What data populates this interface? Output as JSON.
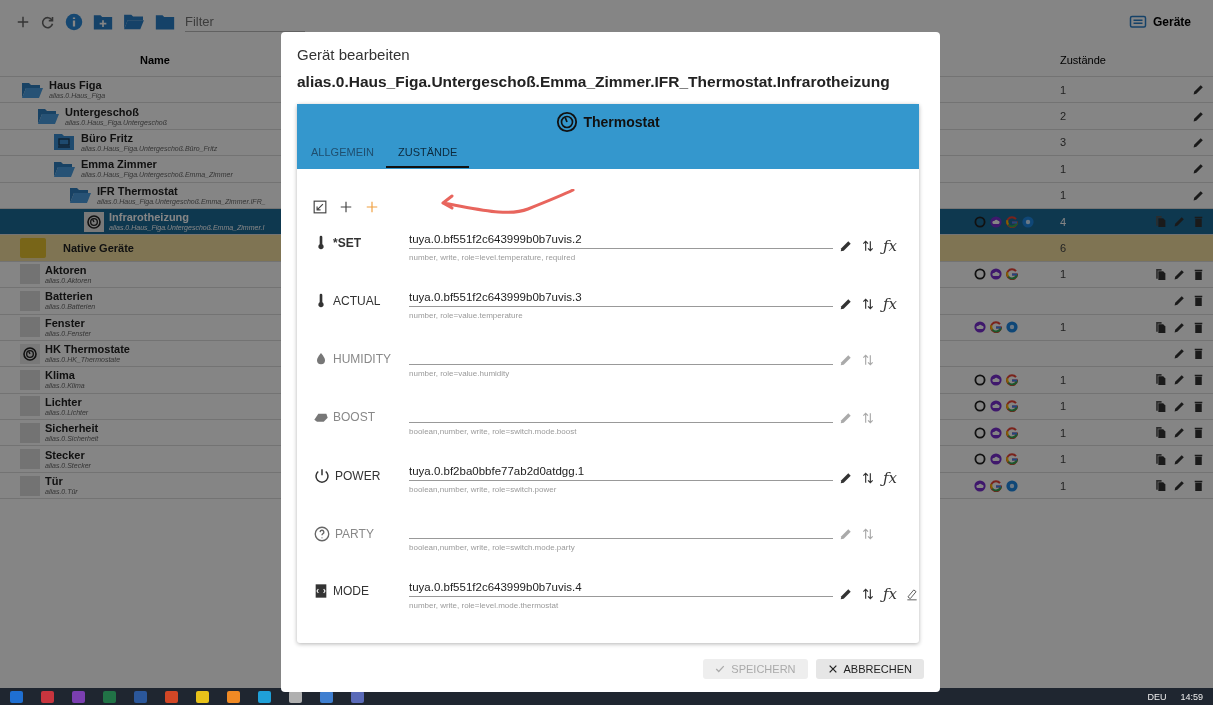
{
  "toolbar": {
    "filter_placeholder": "Filter"
  },
  "header_title": "Geräte",
  "columns": {
    "name": "Name",
    "states": "Zustände"
  },
  "tree": [
    {
      "kind": "folder-open",
      "name": "Haus Figa",
      "id": "alias.0.Haus_Figa",
      "count": "1",
      "actions": [
        {
          "kind": "edit"
        }
      ],
      "selected": false,
      "children": [
        {
          "kind": "folder-open",
          "name": "Untergeschoß",
          "id": "alias.0.Haus_Figa.Untergeschoß",
          "count": "2",
          "actions": [
            {
              "kind": "edit"
            }
          ],
          "selected": false,
          "children": [
            {
              "kind": "folder-laptop",
              "name": "Büro Fritz",
              "id": "alias.0.Haus_Figa.Untergeschoß.Büro_Fritz",
              "count": "3",
              "actions": [
                {
                  "kind": "edit"
                }
              ],
              "selected": false
            },
            {
              "kind": "folder-open",
              "name": "Emma Zimmer",
              "id": "alias.0.Haus_Figa.Untergeschoß.Emma_Zimmer",
              "count": "1",
              "actions": [
                {
                  "kind": "edit"
                }
              ],
              "selected": false,
              "children": [
                {
                  "kind": "folder-open",
                  "name": "IFR Thermostat",
                  "id": "alias.0.Haus_Figa.Untergeschoß.Emma_Zimmer.IFR_",
                  "count": "1",
                  "actions": [
                    {
                      "kind": "edit"
                    }
                  ],
                  "selected": false,
                  "children": [
                    {
                      "kind": "thermostat",
                      "name": "Infrarotheizung",
                      "id": "alias.0.Haus_Figa.Untergeschoß.Emma_Zimmer.I",
                      "count": "4",
                      "actions": [
                        {
                          "kind": "copy"
                        },
                        {
                          "kind": "edit"
                        },
                        {
                          "kind": "delete"
                        }
                      ],
                      "badges": [
                        {
                          "kind": "ring"
                        },
                        {
                          "kind": "cloud"
                        },
                        {
                          "kind": "g"
                        },
                        {
                          "kind": "dot"
                        }
                      ],
                      "selected": true
                    }
                  ]
                }
              ]
            }
          ]
        }
      ]
    }
  ],
  "native": {
    "name": "Native Geräte",
    "count": "6",
    "items": [
      {
        "kind": "blank",
        "name": "Aktoren",
        "id": "alias.0.Aktoren",
        "count": "1",
        "actions": [
          {
            "kind": "copy"
          },
          {
            "kind": "edit"
          },
          {
            "kind": "delete"
          }
        ],
        "badges": [
          {
            "kind": "ring"
          },
          {
            "kind": "cloud"
          },
          {
            "kind": "g"
          }
        ],
        "selected": false
      },
      {
        "kind": "blank",
        "name": "Batterien",
        "id": "alias.0.Batterien",
        "actions": [
          {
            "kind": "edit"
          },
          {
            "kind": "delete"
          }
        ],
        "selected": false
      },
      {
        "kind": "blank",
        "name": "Fenster",
        "id": "alias.0.Fenster",
        "count": "1",
        "actions": [
          {
            "kind": "copy"
          },
          {
            "kind": "edit"
          },
          {
            "kind": "delete"
          }
        ],
        "badges": [
          {
            "kind": "cloud"
          },
          {
            "kind": "g"
          },
          {
            "kind": "dot"
          }
        ],
        "selected": false
      },
      {
        "kind": "thermostat",
        "name": "HK Thermostate",
        "id": "alias.0.HK_Thermostate",
        "actions": [
          {
            "kind": "edit"
          },
          {
            "kind": "delete"
          }
        ],
        "selected": false
      },
      {
        "kind": "blank",
        "name": "Klima",
        "id": "alias.0.Klima",
        "count": "1",
        "actions": [
          {
            "kind": "copy"
          },
          {
            "kind": "edit"
          },
          {
            "kind": "delete"
          }
        ],
        "badges": [
          {
            "kind": "ring"
          },
          {
            "kind": "cloud"
          },
          {
            "kind": "g"
          }
        ],
        "selected": false
      },
      {
        "kind": "blank",
        "name": "Lichter",
        "id": "alias.0.Lichter",
        "count": "1",
        "actions": [
          {
            "kind": "copy"
          },
          {
            "kind": "edit"
          },
          {
            "kind": "delete"
          }
        ],
        "badges": [
          {
            "kind": "ring"
          },
          {
            "kind": "cloud"
          },
          {
            "kind": "g"
          }
        ],
        "selected": false
      },
      {
        "kind": "blank",
        "name": "Sicherheit",
        "id": "alias.0.Sicherheit",
        "count": "1",
        "actions": [
          {
            "kind": "copy"
          },
          {
            "kind": "edit"
          },
          {
            "kind": "delete"
          }
        ],
        "badges": [
          {
            "kind": "ring"
          },
          {
            "kind": "cloud"
          },
          {
            "kind": "g"
          }
        ],
        "selected": false
      },
      {
        "kind": "blank",
        "name": "Stecker",
        "id": "alias.0.Stecker",
        "count": "1",
        "actions": [
          {
            "kind": "copy"
          },
          {
            "kind": "edit"
          },
          {
            "kind": "delete"
          }
        ],
        "badges": [
          {
            "kind": "ring"
          },
          {
            "kind": "cloud"
          },
          {
            "kind": "g"
          }
        ],
        "selected": false
      },
      {
        "kind": "blank",
        "name": "Tür",
        "id": "alias.0.Tür",
        "count": "1",
        "actions": [
          {
            "kind": "copy"
          },
          {
            "kind": "edit"
          },
          {
            "kind": "delete"
          }
        ],
        "badges": [
          {
            "kind": "cloud"
          },
          {
            "kind": "g"
          },
          {
            "kind": "dot"
          }
        ],
        "selected": false
      }
    ]
  },
  "dialog": {
    "title": "Gerät bearbeiten",
    "subtitle": "alias.0.Haus_Figa.Untergeschoß.Emma_Zimmer.IFR_Thermostat.Infrarotheizung",
    "device_type": "Thermostat",
    "tabs": [
      {
        "label": "ALLGEMEIN",
        "selected": false
      },
      {
        "label": "ZUSTÄNDE",
        "selected": true
      }
    ],
    "states": [
      {
        "kind": "thermometer",
        "label": "*SET",
        "required": true,
        "disabled": false,
        "value": "tuya.0.bf551f2c643999b0b7uvis.2",
        "hint": "number, write, role=level.temperature, required",
        "actions": [
          {
            "kind": "edit"
          },
          {
            "kind": "swap"
          },
          {
            "kind": "fx",
            "label": "ƒx"
          }
        ]
      },
      {
        "kind": "thermometer",
        "label": "ACTUAL",
        "required": false,
        "disabled": false,
        "value": "tuya.0.bf551f2c643999b0b7uvis.3",
        "hint": "number, role=value.temperature",
        "actions": [
          {
            "kind": "edit"
          },
          {
            "kind": "swap"
          },
          {
            "kind": "fx",
            "label": "ƒx"
          }
        ]
      },
      {
        "kind": "drop",
        "label": "HUMIDITY",
        "required": false,
        "disabled": true,
        "hint": "number, role=value.humidity",
        "actions": [
          {
            "kind": "edit"
          },
          {
            "kind": "swap"
          }
        ]
      },
      {
        "kind": "boost",
        "label": "BOOST",
        "required": false,
        "disabled": true,
        "hint": "boolean,number, write, role=switch.mode.boost",
        "actions": [
          {
            "kind": "edit"
          },
          {
            "kind": "swap"
          }
        ]
      },
      {
        "kind": "power",
        "label": "POWER",
        "required": false,
        "disabled": false,
        "value": "tuya.0.bf2ba0bbfe77ab2d0atdgg.1",
        "hint": "boolean,number, write, role=switch.power",
        "actions": [
          {
            "kind": "edit"
          },
          {
            "kind": "swap"
          },
          {
            "kind": "fx",
            "label": "ƒx"
          }
        ]
      },
      {
        "kind": "help",
        "label": "PARTY",
        "required": false,
        "disabled": true,
        "hint": "boolean,number, write, role=switch.mode.party",
        "actions": [
          {
            "kind": "edit"
          },
          {
            "kind": "swap"
          }
        ]
      },
      {
        "kind": "mode",
        "label": "MODE",
        "required": false,
        "disabled": false,
        "value": "tuya.0.bf551f2c643999b0b7uvis.4",
        "hint": "number, write, role=level.mode.thermostat",
        "actions": [
          {
            "kind": "edit"
          },
          {
            "kind": "swap"
          },
          {
            "kind": "fx",
            "label": "ƒx"
          },
          {
            "kind": "clear"
          }
        ]
      }
    ],
    "buttons": [
      {
        "kind": "save",
        "label": "SPEICHERN",
        "disabled": true
      },
      {
        "kind": "cancel",
        "label": "ABBRECHEN",
        "disabled": false
      }
    ]
  },
  "taskbar": {
    "apps": [
      {
        "color": "#1f6fd1"
      },
      {
        "color": "#c7353e"
      },
      {
        "color": "#7b3fb0"
      },
      {
        "color": "#217346"
      },
      {
        "color": "#2b579a"
      },
      {
        "color": "#d24726"
      },
      {
        "color": "#e8c21a"
      },
      {
        "color": "#f08a24"
      },
      {
        "color": "#1fa0d8"
      },
      {
        "color": "#b0b0b0"
      },
      {
        "color": "#3f7fd0"
      },
      {
        "color": "#5a6ab8"
      }
    ],
    "language": "DEU",
    "time": "14:59"
  }
}
